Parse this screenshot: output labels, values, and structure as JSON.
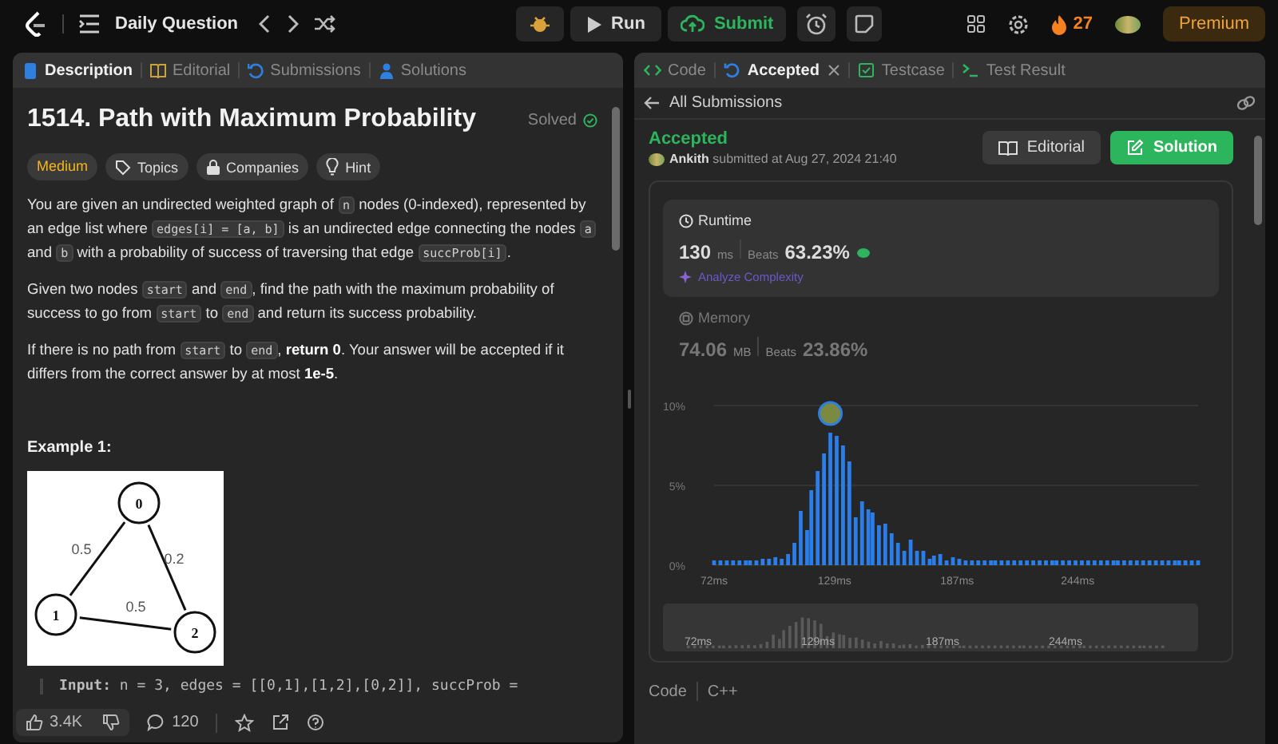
{
  "top_bar": {
    "title": "Daily Question",
    "run_label": "Run",
    "submit_label": "Submit",
    "streak": "27",
    "premium_label": "Premium"
  },
  "left_tabs": [
    {
      "label": "Description",
      "kind": "description",
      "selected": true
    },
    {
      "label": "Editorial",
      "kind": "editorial",
      "selected": false
    },
    {
      "label": "Submissions",
      "kind": "submissions",
      "selected": false
    },
    {
      "label": "Solutions",
      "kind": "solutions",
      "selected": false
    }
  ],
  "problem": {
    "title": "1514. Path with Maximum Probability",
    "status": "Solved",
    "tags": [
      {
        "label": "Medium",
        "kind": "difficulty"
      },
      {
        "label": "Topics",
        "kind": "topics"
      },
      {
        "label": "Companies",
        "kind": "companies"
      },
      {
        "label": "Hint",
        "kind": "hint"
      }
    ],
    "paragraphs": [
      [
        {
          "kind": "text",
          "text": "You are given an undirected weighted graph of "
        },
        {
          "kind": "code",
          "text": "n"
        },
        {
          "kind": "text",
          "text": " nodes (0-indexed), represented by an edge list where "
        },
        {
          "kind": "code",
          "text": "edges[i] = [a, b]"
        },
        {
          "kind": "text",
          "text": " is an undirected edge connecting the nodes "
        },
        {
          "kind": "code",
          "text": "a"
        },
        {
          "kind": "text",
          "text": " and "
        },
        {
          "kind": "code",
          "text": "b"
        },
        {
          "kind": "text",
          "text": " with a probability of success of traversing that edge "
        },
        {
          "kind": "code",
          "text": "succProb[i]"
        },
        {
          "kind": "text",
          "text": "."
        }
      ],
      [
        {
          "kind": "text",
          "text": "Given two nodes "
        },
        {
          "kind": "code",
          "text": "start"
        },
        {
          "kind": "text",
          "text": " and "
        },
        {
          "kind": "code",
          "text": "end"
        },
        {
          "kind": "text",
          "text": ", find the path with the maximum probability of success to go from "
        },
        {
          "kind": "code",
          "text": "start"
        },
        {
          "kind": "text",
          "text": " to "
        },
        {
          "kind": "code",
          "text": "end"
        },
        {
          "kind": "text",
          "text": " and return its success probability."
        }
      ],
      [
        {
          "kind": "text",
          "text": "If there is no path from "
        },
        {
          "kind": "code",
          "text": "start"
        },
        {
          "kind": "text",
          "text": " to "
        },
        {
          "kind": "code",
          "text": "end"
        },
        {
          "kind": "text",
          "text": ", "
        },
        {
          "kind": "bold",
          "text": "return 0"
        },
        {
          "kind": "text",
          "text": ". Your answer will be accepted if it differs from the correct answer by at most "
        },
        {
          "kind": "bold",
          "text": "1e-5"
        },
        {
          "kind": "text",
          "text": "."
        }
      ]
    ],
    "example_heading": "Example 1:",
    "graph": {
      "nodes": [
        {
          "label": "0"
        },
        {
          "label": "1"
        },
        {
          "label": "2"
        }
      ],
      "edges": [
        {
          "label": "0.5"
        },
        {
          "label": "0.2"
        },
        {
          "label": "0.5"
        }
      ]
    },
    "example_input": "**Input:** n = 3, edges = [[0,1],[1,2],[0,2]], succProb ="
  },
  "bottom_bar": {
    "likes": "3.4K",
    "comments": "120"
  },
  "right_tabs": [
    {
      "label": "Code",
      "kind": "code",
      "selected": false,
      "closable": false
    },
    {
      "label": "Accepted",
      "kind": "accepted",
      "selected": true,
      "closable": true
    },
    {
      "label": "Testcase",
      "kind": "testcase",
      "selected": false,
      "closable": false
    },
    {
      "label": "Test Result",
      "kind": "result",
      "selected": false,
      "closable": false
    }
  ],
  "submission": {
    "back_label": "All Submissions",
    "status": "Accepted",
    "user": "Ankith",
    "submitted_text": "submitted at Aug 27, 2024 21:40",
    "editorial_label": "Editorial",
    "solution_label": "Solution"
  },
  "stats": [
    {
      "kind": "runtime",
      "heading": "Runtime",
      "value": "130",
      "unit": "ms",
      "beats_label": "Beats",
      "beats": "63.23%",
      "analyze_label": "Analyze Complexity",
      "selected": true
    },
    {
      "kind": "memory",
      "heading": "Memory",
      "value": "74.06",
      "unit": "MB",
      "beats_label": "Beats",
      "beats": "23.86%",
      "selected": false
    }
  ],
  "chart_data": {
    "type": "bar",
    "x": [
      72,
      75,
      78,
      81,
      84,
      87,
      89,
      92,
      95,
      98,
      101,
      104,
      107,
      110,
      113,
      116,
      118,
      121,
      124,
      127,
      130,
      133,
      136,
      139,
      142,
      145,
      147,
      150,
      153,
      156,
      159,
      162,
      165,
      168,
      171,
      174,
      176,
      179,
      182,
      185,
      188,
      191,
      194,
      197,
      200,
      203,
      205,
      208,
      211,
      214,
      217,
      220,
      223,
      226,
      229,
      232,
      234,
      237,
      240,
      243,
      246,
      249,
      252,
      255,
      258,
      261,
      263,
      266,
      269,
      272,
      275,
      278,
      281,
      284,
      287,
      290,
      292,
      295,
      298,
      301
    ],
    "series": [
      {
        "color": "#2b7de9",
        "values": [
          0.3,
          0.3,
          0.3,
          0.3,
          0.3,
          0.3,
          0.3,
          0.3,
          0.4,
          0.4,
          0.5,
          0.4,
          0.7,
          1.4,
          3.4,
          2.2,
          4.7,
          5.9,
          7.0,
          8.3,
          8.1,
          7.5,
          6.5,
          3.0,
          4.0,
          3.5,
          3.3,
          2.5,
          2.6,
          2.0,
          1.4,
          0.9,
          1.6,
          0.9,
          0.9,
          0.4,
          0.6,
          0.7,
          0.3,
          0.5,
          0.4,
          0.3,
          0.3,
          0.3,
          0.3,
          0.3,
          0.3,
          0.3,
          0.3,
          0.3,
          0.3,
          0.3,
          0.3,
          0.3,
          0.3,
          0.3,
          0.3,
          0.3,
          0.3,
          0.3,
          0.3,
          0.3,
          0.3,
          0.3,
          0.3,
          0.3,
          0.3,
          0.3,
          0.3,
          0.3,
          0.3,
          0.3,
          0.3,
          0.3,
          0.3,
          0.3,
          0.3,
          0.3,
          0.3,
          0.3
        ]
      }
    ],
    "xlim": [
      72,
      301
    ],
    "ylim": [
      0,
      10
    ],
    "xticks": [
      {
        "value": 72,
        "label": "72ms"
      },
      {
        "value": 129,
        "label": "129ms"
      },
      {
        "value": 187,
        "label": "187ms"
      },
      {
        "value": 244,
        "label": "244ms"
      }
    ],
    "yticks": [
      {
        "value": 0,
        "label": "0%"
      },
      {
        "value": 5,
        "label": "5%"
      },
      {
        "value": 10,
        "label": "10%"
      }
    ]
  },
  "navigator": {
    "labels": [
      "72ms",
      "129ms",
      "187ms",
      "244ms"
    ]
  },
  "footer": {
    "label": "Code",
    "language": "C++"
  }
}
